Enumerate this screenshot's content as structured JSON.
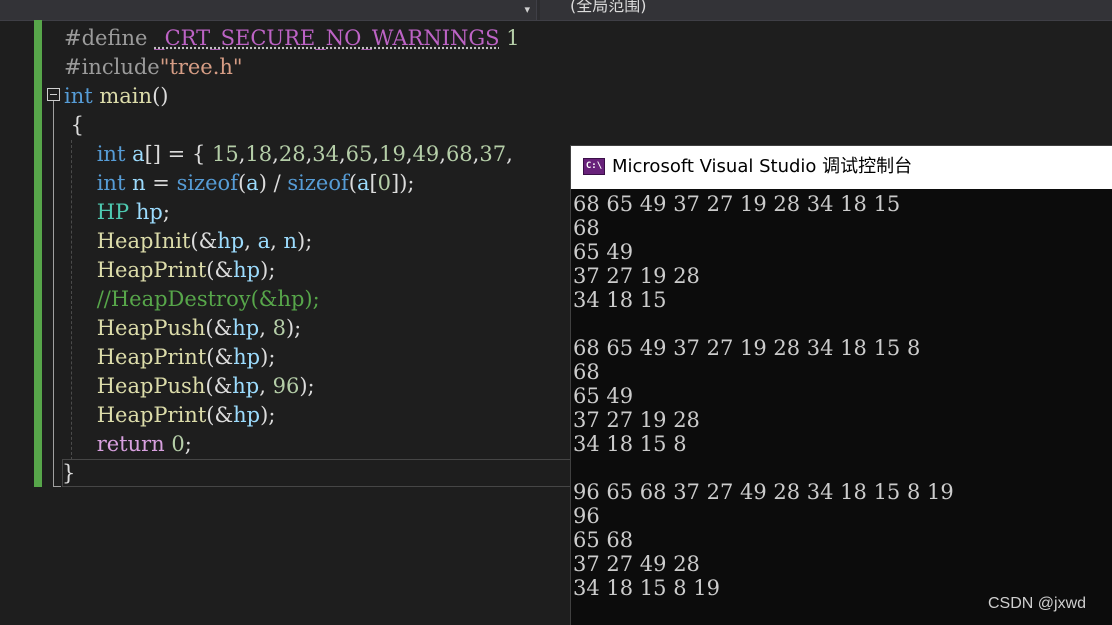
{
  "topbar": {
    "left_dropdown_arrow": "▾",
    "scope_label": "(全局范围)"
  },
  "editor": {
    "lines": [
      [
        {
          "t": "#define ",
          "c": "pp"
        },
        {
          "t": "_CRT_SECURE_NO_WARNINGS",
          "c": "mac"
        },
        {
          "t": " 1",
          "c": "num"
        }
      ],
      [
        {
          "t": "#include",
          "c": "pp"
        },
        {
          "t": "\"tree.h\"",
          "c": "str"
        }
      ],
      [
        {
          "t": "int",
          "c": "kw"
        },
        {
          "t": " ",
          "c": "plain"
        },
        {
          "t": "main",
          "c": "fn"
        },
        {
          "t": "()",
          "c": "plain"
        }
      ],
      [
        {
          "t": " {",
          "c": "plain"
        }
      ],
      [
        {
          "t": "    ",
          "c": "plain"
        },
        {
          "t": "int",
          "c": "kw"
        },
        {
          "t": " ",
          "c": "plain"
        },
        {
          "t": "a",
          "c": "var"
        },
        {
          "t": "[] = { ",
          "c": "plain"
        },
        {
          "t": "15",
          "c": "num"
        },
        {
          "t": ",",
          "c": "plain"
        },
        {
          "t": "18",
          "c": "num"
        },
        {
          "t": ",",
          "c": "plain"
        },
        {
          "t": "28",
          "c": "num"
        },
        {
          "t": ",",
          "c": "plain"
        },
        {
          "t": "34",
          "c": "num"
        },
        {
          "t": ",",
          "c": "plain"
        },
        {
          "t": "65",
          "c": "num"
        },
        {
          "t": ",",
          "c": "plain"
        },
        {
          "t": "19",
          "c": "num"
        },
        {
          "t": ",",
          "c": "plain"
        },
        {
          "t": "49",
          "c": "num"
        },
        {
          "t": ",",
          "c": "plain"
        },
        {
          "t": "68",
          "c": "num"
        },
        {
          "t": ",",
          "c": "plain"
        },
        {
          "t": "37",
          "c": "num"
        },
        {
          "t": ",",
          "c": "plain"
        }
      ],
      [
        {
          "t": "    ",
          "c": "plain"
        },
        {
          "t": "int",
          "c": "kw"
        },
        {
          "t": " ",
          "c": "plain"
        },
        {
          "t": "n",
          "c": "var"
        },
        {
          "t": " = ",
          "c": "plain"
        },
        {
          "t": "sizeof",
          "c": "kw"
        },
        {
          "t": "(",
          "c": "plain"
        },
        {
          "t": "a",
          "c": "var"
        },
        {
          "t": ") / ",
          "c": "plain"
        },
        {
          "t": "sizeof",
          "c": "kw"
        },
        {
          "t": "(",
          "c": "plain"
        },
        {
          "t": "a",
          "c": "var"
        },
        {
          "t": "[",
          "c": "plain"
        },
        {
          "t": "0",
          "c": "num"
        },
        {
          "t": "]);",
          "c": "plain"
        }
      ],
      [
        {
          "t": "    ",
          "c": "plain"
        },
        {
          "t": "HP",
          "c": "ty"
        },
        {
          "t": " ",
          "c": "plain"
        },
        {
          "t": "hp",
          "c": "var"
        },
        {
          "t": ";",
          "c": "plain"
        }
      ],
      [
        {
          "t": "    ",
          "c": "plain"
        },
        {
          "t": "HeapInit",
          "c": "fn"
        },
        {
          "t": "(&",
          "c": "plain"
        },
        {
          "t": "hp",
          "c": "var"
        },
        {
          "t": ", ",
          "c": "plain"
        },
        {
          "t": "a",
          "c": "var"
        },
        {
          "t": ", ",
          "c": "plain"
        },
        {
          "t": "n",
          "c": "var"
        },
        {
          "t": ");",
          "c": "plain"
        }
      ],
      [
        {
          "t": "    ",
          "c": "plain"
        },
        {
          "t": "HeapPrint",
          "c": "fn"
        },
        {
          "t": "(&",
          "c": "plain"
        },
        {
          "t": "hp",
          "c": "var"
        },
        {
          "t": ");",
          "c": "plain"
        }
      ],
      [
        {
          "t": "    ",
          "c": "plain"
        },
        {
          "t": "//HeapDestroy(&hp);",
          "c": "cm"
        }
      ],
      [
        {
          "t": "    ",
          "c": "plain"
        },
        {
          "t": "HeapPush",
          "c": "fn"
        },
        {
          "t": "(&",
          "c": "plain"
        },
        {
          "t": "hp",
          "c": "var"
        },
        {
          "t": ", ",
          "c": "plain"
        },
        {
          "t": "8",
          "c": "num"
        },
        {
          "t": ");",
          "c": "plain"
        }
      ],
      [
        {
          "t": "    ",
          "c": "plain"
        },
        {
          "t": "HeapPrint",
          "c": "fn"
        },
        {
          "t": "(&",
          "c": "plain"
        },
        {
          "t": "hp",
          "c": "var"
        },
        {
          "t": ");",
          "c": "plain"
        }
      ],
      [
        {
          "t": "    ",
          "c": "plain"
        },
        {
          "t": "HeapPush",
          "c": "fn"
        },
        {
          "t": "(&",
          "c": "plain"
        },
        {
          "t": "hp",
          "c": "var"
        },
        {
          "t": ", ",
          "c": "plain"
        },
        {
          "t": "96",
          "c": "num"
        },
        {
          "t": ");",
          "c": "plain"
        }
      ],
      [
        {
          "t": "    ",
          "c": "plain"
        },
        {
          "t": "HeapPrint",
          "c": "fn"
        },
        {
          "t": "(&",
          "c": "plain"
        },
        {
          "t": "hp",
          "c": "var"
        },
        {
          "t": ");",
          "c": "plain"
        }
      ],
      [
        {
          "t": "    ",
          "c": "plain"
        },
        {
          "t": "return",
          "c": "ctl"
        },
        {
          "t": " ",
          "c": "plain"
        },
        {
          "t": "0",
          "c": "num"
        },
        {
          "t": ";",
          "c": "plain"
        }
      ],
      [
        {
          "t": "}",
          "c": "plain"
        }
      ]
    ]
  },
  "console": {
    "title": "Microsoft Visual Studio 调试控制台",
    "icon_text": "C:\\",
    "lines": [
      "68 65 49 37 27 19 28 34 18 15",
      "68",
      "65 49",
      "37 27 19 28",
      "34 18 15",
      "",
      "68 65 49 37 27 19 28 34 18 15 8",
      "68",
      "65 49",
      "37 27 19 28",
      "34 18 15 8",
      "",
      "96 65 68 37 27 49 28 34 18 15 8 19",
      "96",
      "65 68",
      "37 27 49 28",
      "34 18 15 8 19"
    ]
  },
  "watermark": "CSDN @jxwd"
}
